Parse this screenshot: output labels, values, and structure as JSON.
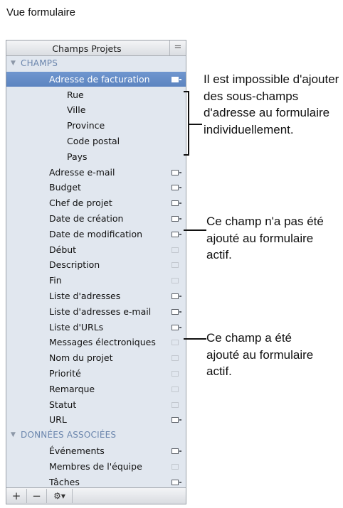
{
  "page": {
    "title": "Vue formulaire"
  },
  "panel": {
    "title": "Champs Projets",
    "menu_glyph": "=",
    "rows": [
      {
        "label": "CHAMPS",
        "type": "section",
        "expanded": true,
        "icon": "disclosure-triangle-icon"
      },
      {
        "label": "Adresse de facturation",
        "type": "field",
        "indent": 1,
        "active": true,
        "selected": true
      },
      {
        "label": "Rue",
        "type": "subfield",
        "indent": 2
      },
      {
        "label": "Ville",
        "type": "subfield",
        "indent": 2
      },
      {
        "label": "Province",
        "type": "subfield",
        "indent": 2
      },
      {
        "label": "Code postal",
        "type": "subfield",
        "indent": 2
      },
      {
        "label": "Pays",
        "type": "subfield",
        "indent": 2
      },
      {
        "label": "Adresse e-mail",
        "type": "field",
        "indent": 1,
        "active": true
      },
      {
        "label": "Budget",
        "type": "field",
        "indent": 1,
        "active": true
      },
      {
        "label": "Chef de projet",
        "type": "field",
        "indent": 1,
        "active": true
      },
      {
        "label": "Date de création",
        "type": "field",
        "indent": 1,
        "active": true
      },
      {
        "label": "Date de modification",
        "type": "field",
        "indent": 1,
        "active": true
      },
      {
        "label": "Début",
        "type": "field",
        "indent": 1,
        "active": false
      },
      {
        "label": "Description",
        "type": "field",
        "indent": 1,
        "active": false
      },
      {
        "label": "Fin",
        "type": "field",
        "indent": 1,
        "active": false
      },
      {
        "label": "Liste d'adresses",
        "type": "field",
        "indent": 1,
        "active": true
      },
      {
        "label": "Liste d'adresses e-mail",
        "type": "field",
        "indent": 1,
        "active": true
      },
      {
        "label": "Liste d'URLs",
        "type": "field",
        "indent": 1,
        "active": true
      },
      {
        "label": "Messages électroniques",
        "type": "field",
        "indent": 1,
        "active": false
      },
      {
        "label": "Nom du projet",
        "type": "field",
        "indent": 1,
        "active": false
      },
      {
        "label": "Priorité",
        "type": "field",
        "indent": 1,
        "active": false
      },
      {
        "label": "Remarque",
        "type": "field",
        "indent": 1,
        "active": false
      },
      {
        "label": "Statut",
        "type": "field",
        "indent": 1,
        "active": false
      },
      {
        "label": "URL",
        "type": "field",
        "indent": 1,
        "active": true
      },
      {
        "label": "DONNÉES ASSOCIÉES",
        "type": "section",
        "expanded": true,
        "icon": "disclosure-triangle-icon"
      },
      {
        "label": "Événements",
        "type": "field",
        "indent": 1,
        "active": true
      },
      {
        "label": "Membres de l'équipe",
        "type": "field",
        "indent": 1,
        "active": false
      },
      {
        "label": "Tâches",
        "type": "field",
        "indent": 1,
        "active": true
      }
    ],
    "footer": {
      "add": "+",
      "remove": "−",
      "action": "⚙▾"
    }
  },
  "callouts": {
    "address": "Il est impossible d'ajouter des sous-champs d'adresse au formulaire individuellement.",
    "not_added": "Ce champ n'a pas été ajouté au formulaire actif.",
    "added": "Ce champ a été ajouté au formulaire actif."
  },
  "colors": {
    "selection": "#6089c5",
    "section_text": "#6b86ad",
    "panel_bg": "#e1e7ef"
  }
}
